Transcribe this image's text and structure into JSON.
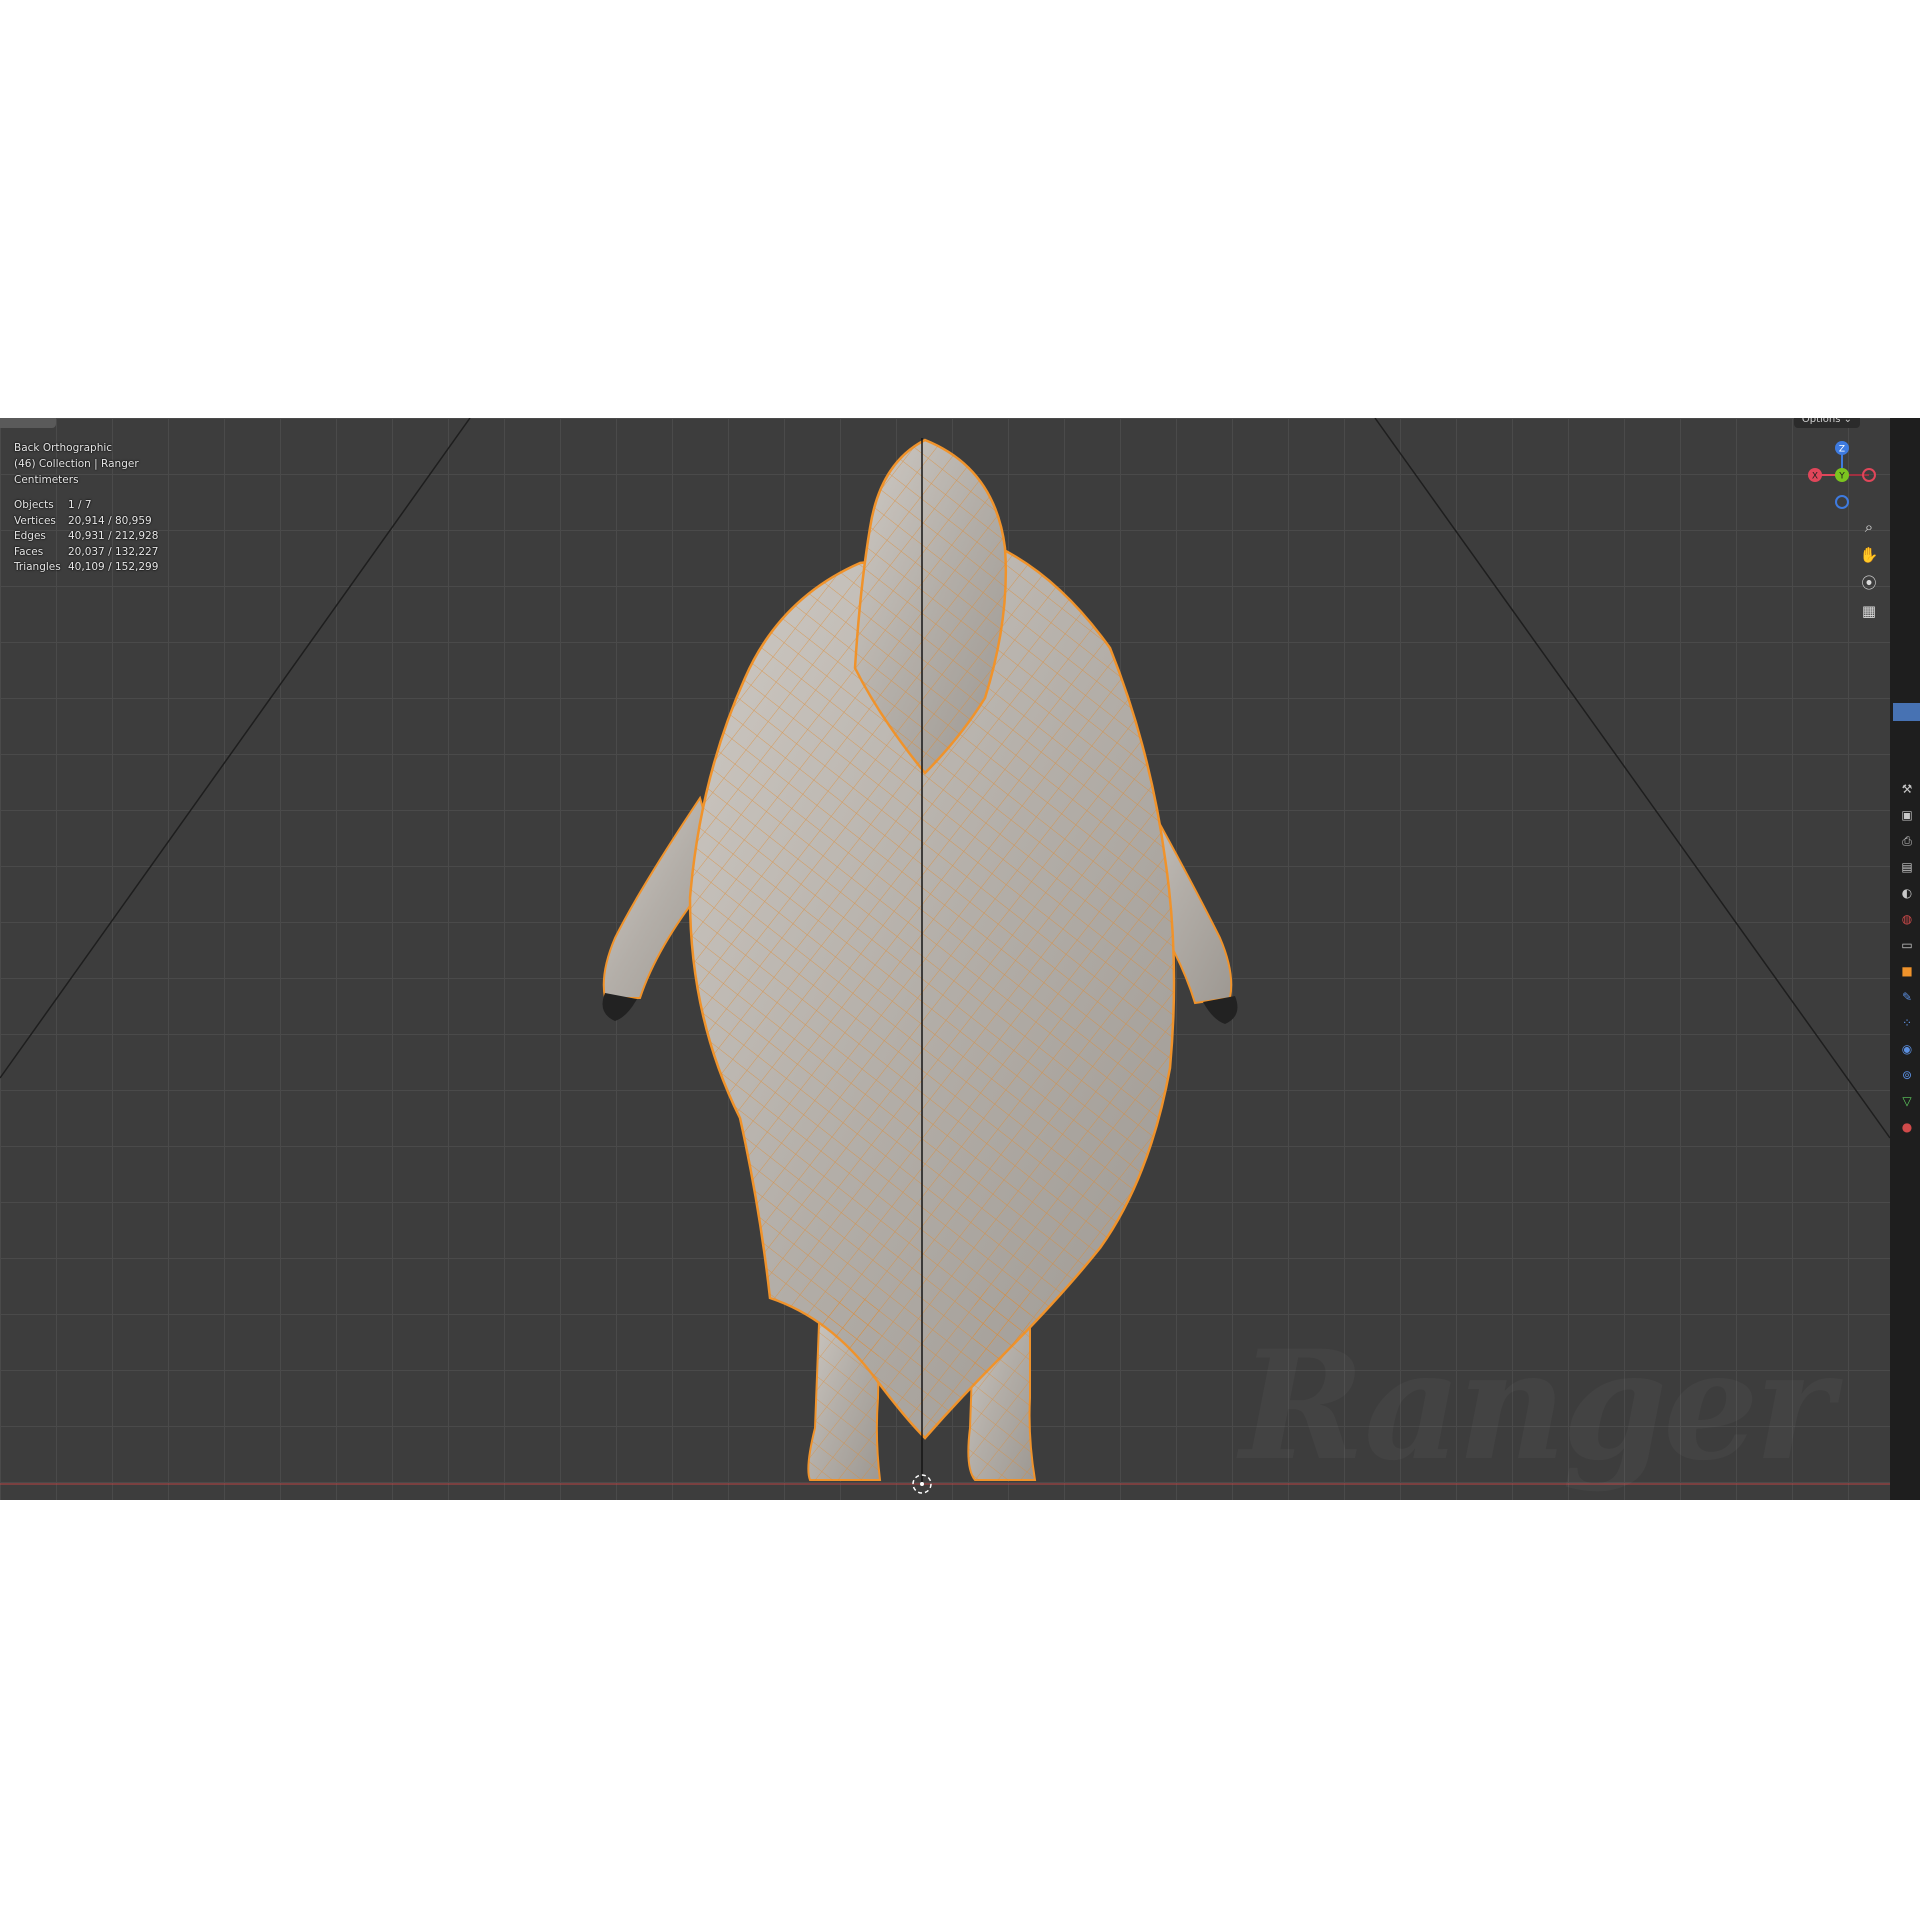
{
  "viewport": {
    "view_name": "Back Orthographic",
    "collection_line": "(46) Collection | Ranger",
    "units": "Centimeters"
  },
  "stats": [
    {
      "label": "Objects",
      "value": "1 / 7"
    },
    {
      "label": "Vertices",
      "value": "20,914 / 80,959"
    },
    {
      "label": "Edges",
      "value": "40,931 / 212,928"
    },
    {
      "label": "Faces",
      "value": "20,037 / 132,227"
    },
    {
      "label": "Triangles",
      "value": "40,109 / 152,299"
    }
  ],
  "header": {
    "options_label": "Options ⌄"
  },
  "gizmo": {
    "x": "X",
    "y": "Y",
    "z": "Z"
  },
  "nav_icons": [
    "zoom-icon",
    "hand-pan-icon",
    "camera-icon",
    "grid-icon"
  ],
  "props_icons": [
    "tool-icon",
    "render-icon",
    "output-icon",
    "view-layer-icon",
    "scene-icon",
    "world-icon",
    "collection-icon",
    "object-icon",
    "modifier-icon",
    "particles-icon",
    "physics-icon",
    "constraints-icon",
    "data-icon",
    "material-icon"
  ],
  "colors": {
    "background": "#3d3d3d",
    "grid": "#4a4a4a",
    "selection_outline": "#f0932b",
    "mesh": "#b8b3ae",
    "axis_x": "#e0465a",
    "axis_y": "#7bc41f",
    "axis_z": "#3e7be0"
  },
  "watermark": "Ranger"
}
